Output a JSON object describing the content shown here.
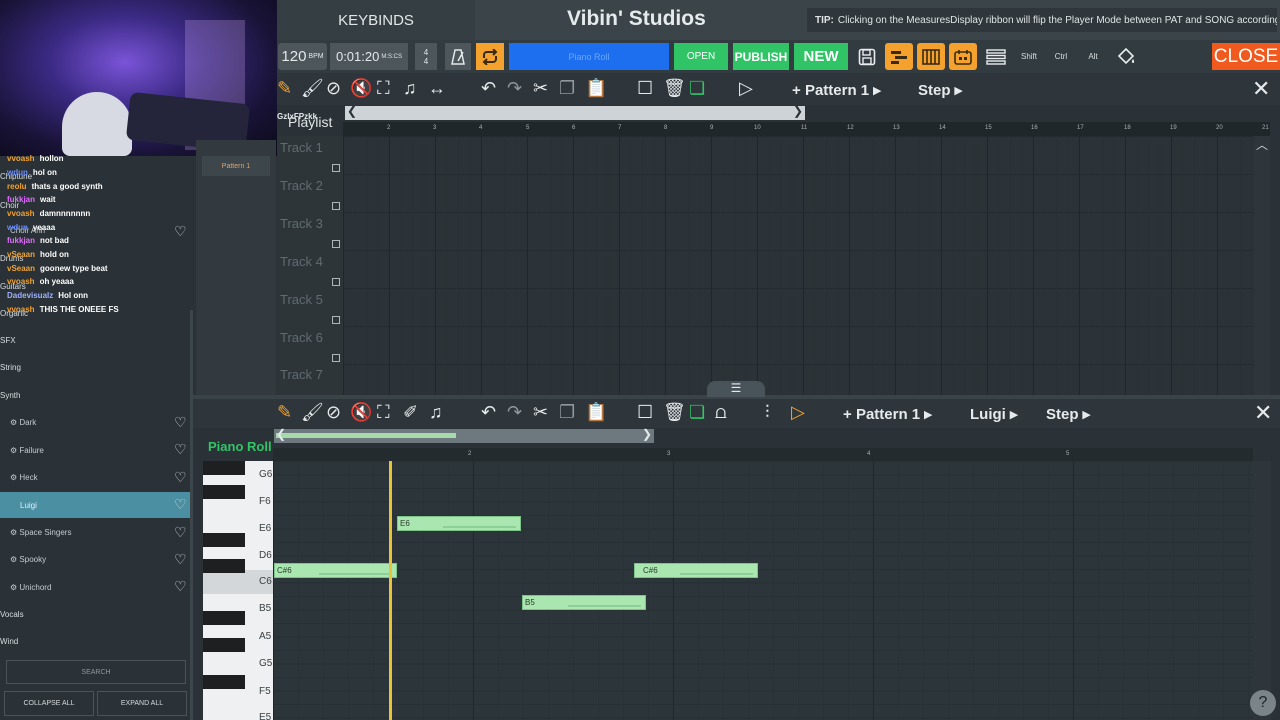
{
  "header": {
    "keybinds": "KEYBINDS",
    "title": "Vibin' Studios",
    "tip_label": "TIP:",
    "tip_text": "Clicking on the MeasuresDisplay ribbon will flip the Player Mode between PAT and SONG accordingly"
  },
  "toolbar": {
    "bpm": "120",
    "bpm_unit": "BPM",
    "time": "0:01:20",
    "time_unit": "M:S:CS",
    "sig_top": "4",
    "sig_bottom": "4",
    "mode_display": "Piano Roll",
    "open": "OPEN",
    "publish": "PUBLISH",
    "new": "NEW",
    "shift": "Shift",
    "ctrl": "Ctrl",
    "alt": "Alt",
    "close": "CLOSE"
  },
  "chat": [
    {
      "user": "vvoash",
      "text": "hollon",
      "color": "#f4a12d"
    },
    {
      "user": "wdun",
      "text": "hol on",
      "color": "#6a8cff"
    },
    {
      "user": "reolu",
      "text": "thats a good synth",
      "color": "#f4a12d"
    },
    {
      "user": "fukkjan",
      "text": "wait",
      "color": "#e06cff"
    },
    {
      "user": "vvoash",
      "text": "damnnnnnnn",
      "color": "#f4a12d"
    },
    {
      "user": "wdun",
      "text": "yeaaa",
      "color": "#6a8cff"
    },
    {
      "user": "fukkjan",
      "text": "not bad",
      "color": "#e06cff"
    },
    {
      "user": "vSeaan",
      "text": "hold on",
      "color": "#f4a12d"
    },
    {
      "user": "vSeaan",
      "text": "goonew type beat",
      "color": "#f4a12d"
    },
    {
      "user": "vvoash",
      "text": "oh yeaaa",
      "color": "#f4a12d"
    },
    {
      "user": "Dadevisualz",
      "text": "Hol onn",
      "color": "#9fb0ff"
    },
    {
      "user": "vvoash",
      "text": "THIS THE ONEEE FS",
      "color": "#f4a12d"
    }
  ],
  "browser": {
    "categories": [
      "Chiptune",
      "Choir",
      "Drums",
      "Guitars",
      "Organic",
      "SFX",
      "String",
      "Synth",
      "Vocals",
      "Wind"
    ],
    "choir_item": "Choir Ahh",
    "synth_items": [
      "Dark",
      "Failure",
      "Heck",
      "Luigi",
      "Space Singers",
      "Spooky",
      "Unichord"
    ],
    "selected": "Luigi",
    "search": "SEARCH",
    "collapse_all": "COLLAPSE ALL",
    "expand_all": "EXPAND ALL"
  },
  "playlist": {
    "overlay_text": "GzlxFPzkk",
    "title": "Playlist",
    "pattern_label": "Pattern 1",
    "step_label": "Step",
    "pattern_item": "Pattern 1",
    "tracks": [
      "Track 1",
      "Track 2",
      "Track 3",
      "Track 4",
      "Track 5",
      "Track 6",
      "Track 7"
    ],
    "ruler": [
      "2",
      "3",
      "4",
      "5",
      "6",
      "7",
      "8",
      "9",
      "10",
      "11",
      "12",
      "13",
      "14",
      "15",
      "16",
      "17",
      "18",
      "19",
      "20",
      "21"
    ]
  },
  "piano_roll": {
    "title": "Piano Roll",
    "pattern_label": "Pattern 1",
    "instrument_label": "Luigi",
    "step_label": "Step",
    "ruler": [
      "2",
      "3",
      "4",
      "5"
    ],
    "keys": [
      "G6",
      "F6",
      "E6",
      "D6",
      "C6",
      "B5",
      "A5",
      "G5",
      "F5",
      "E5"
    ],
    "notes": [
      {
        "pitch": "C#6",
        "label": "C#6",
        "start": 0.0,
        "length": 1.25
      },
      {
        "pitch": "E6",
        "label": "E6",
        "start": 1.25,
        "length": 1.25
      },
      {
        "pitch": "B5",
        "label": "B5",
        "start": 2.5,
        "length": 1.25
      },
      {
        "pitch": "C#6",
        "label": "C#6",
        "start": 3.6,
        "length": 1.25
      }
    ],
    "playhead_beat": 1.17
  },
  "colors": {
    "accent_green": "#31c466",
    "accent_orange": "#f4a12d",
    "accent_blue": "#1e6ef0",
    "close_red": "#f05a1e"
  }
}
